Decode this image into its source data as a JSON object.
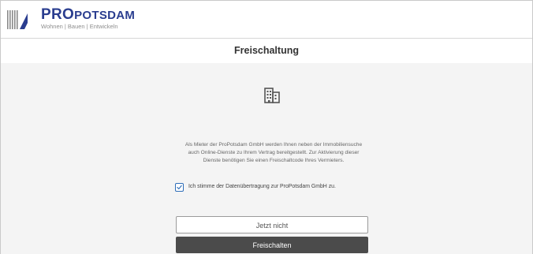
{
  "header": {
    "brand_prefix": "Pro",
    "brand_suffix": "Potsdam",
    "tagline": "Wohnen | Bauen | Entwickeln",
    "logo_icon": "propotsdam-logo-icon"
  },
  "page": {
    "title": "Freischaltung"
  },
  "content": {
    "icon": "building-icon",
    "message": "Als Mieter der ProPotsdam GmbH werden Ihnen neben der Immobiliensuche auch Online-Dienste zu Ihrem Vertrag bereitgestellt. Zur Aktivierung dieser Dienste benötigen Sie einen Freischaltcode Ihres Vermieters.",
    "consent_label": "Ich stimme der Datenübertragung zur ProPotsdam GmbH zu.",
    "consent_checked": true
  },
  "actions": {
    "secondary_label": "Jetzt nicht",
    "primary_label": "Freischalten"
  },
  "colors": {
    "brand_blue": "#2a3d8f",
    "checkbox_blue": "#2d6db8",
    "primary_button": "#4b4b4b",
    "content_background": "#f4f4f4"
  }
}
